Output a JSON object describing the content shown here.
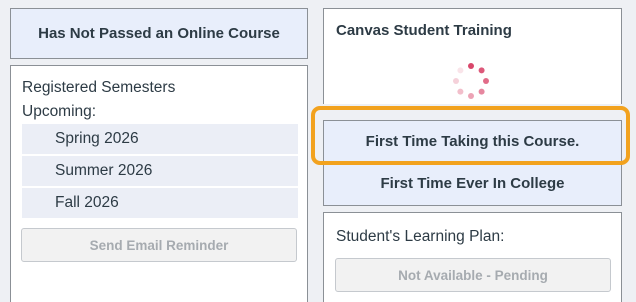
{
  "left": {
    "online_status": "Has Not Passed an Online Course",
    "registered_label": "Registered Semesters",
    "upcoming_label": "Upcoming:",
    "semesters": [
      "Spring 2026",
      "Summer 2026",
      "Fall 2026"
    ],
    "email_button": "Send Email Reminder"
  },
  "right": {
    "training_title": "Canvas Student Training",
    "first_time_course": "First Time Taking this Course.",
    "first_time_college": "First Time Ever In College",
    "learning_plan_label": "Student's Learning Plan:",
    "learning_plan_button": "Not Available - Pending"
  },
  "icons": {
    "loading": "loading-spinner-icon"
  },
  "colors": {
    "highlight": "#f2a21e",
    "panel_blue": "#e8eefb"
  }
}
